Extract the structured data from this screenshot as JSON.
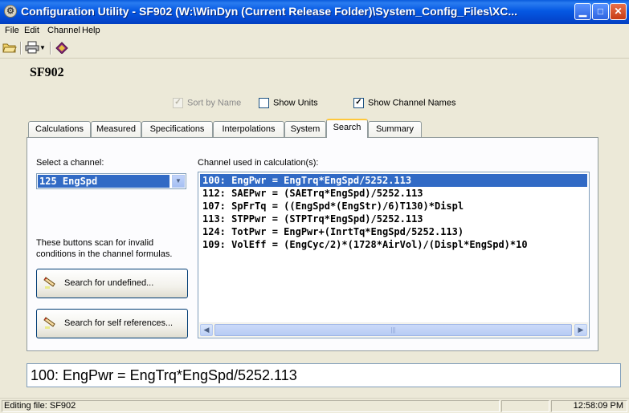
{
  "window": {
    "title": "Configuration Utility - SF902  (W:\\WinDyn (Current Release Folder)\\System_Config_Files\\XC...",
    "icon": "app-icon",
    "controls": [
      "minimize-icon",
      "maximize-icon",
      "close-icon"
    ]
  },
  "menu": {
    "items": [
      "File",
      "Edit",
      "Channel",
      "Help"
    ]
  },
  "toolbar": {
    "icons": [
      "open-folder-icon",
      "print-icon",
      "dropdown-arrow-icon",
      "book-icon"
    ]
  },
  "header": {
    "name": "SF902"
  },
  "options": {
    "sort_by_name": {
      "label": "Sort by Name",
      "checked": true,
      "enabled": false
    },
    "show_units": {
      "label": "Show Units",
      "checked": false,
      "enabled": true
    },
    "show_channel_names": {
      "label": "Show Channel Names",
      "checked": true,
      "enabled": true
    }
  },
  "tabs": [
    "Calculations",
    "Measured",
    "Specifications",
    "Interpolations",
    "System",
    "Search",
    "Summary"
  ],
  "active_tab": "Search",
  "search": {
    "select_label": "Select a channel:",
    "selected_channel": "125  EngSpd",
    "used_label": "Channel used in calculation(s):",
    "results": [
      "100: EngPwr = EngTrq*EngSpd/5252.113",
      "112: SAEPwr = (SAETrq*EngSpd)/5252.113",
      "107: SpFrTq = ((EngSpd*(EngStr)/6)T130)*Displ",
      "113: STPPwr = (STPTrq*EngSpd)/5252.113",
      "124: TotPwr = EngPwr+(InrtTq*EngSpd/5252.113)",
      "109: VolEff = (EngCyc/2)*(1728*AirVol)/(Displ*EngSpd)*10"
    ],
    "selected_index": 0,
    "hint": "These buttons scan for invalid conditions in the channel formulas.",
    "btn_undefined": "Search for undefined...",
    "btn_self": "Search for self references..."
  },
  "formula_display": "100: EngPwr = EngTrq*EngSpd/5252.113",
  "status": {
    "file": "Editing file: SF902",
    "time": "12:58:09 PM"
  },
  "colors": {
    "selection": "#316ac5",
    "titlebar": "#0558e3",
    "face": "#ece9d8"
  }
}
